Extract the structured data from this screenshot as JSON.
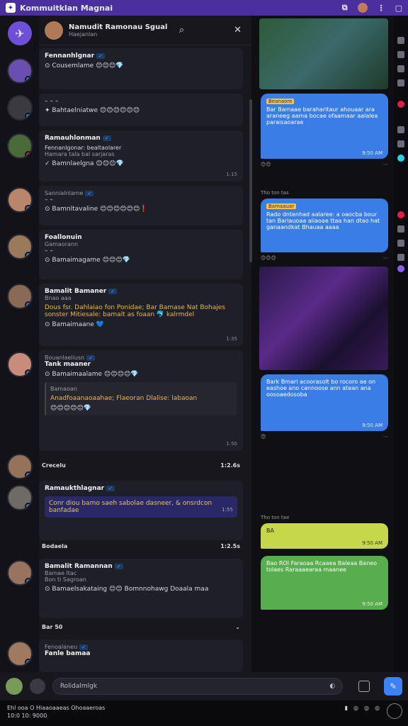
{
  "titlebar": {
    "title": "Kommuitklan Magnai"
  },
  "chat_header": {
    "title": "Namudit Ramonau Sgual",
    "subtitle": "Haejanlan"
  },
  "messages": [
    {
      "name": "Fennanhlgnar",
      "text": "Cousemlame"
    },
    {
      "name": "",
      "text": "Bahtaelniatwe"
    },
    {
      "name": "Ramauhlonman",
      "text": "Fennanlgonar: bealtaolarer",
      "line2": "Hamara tala bal sarjaras",
      "time": "1:15"
    },
    {
      "name": "Sannialnlame",
      "sub": "",
      "text": "Bamnltavaline"
    },
    {
      "name": "Foallonuin",
      "sub": "Gamaorann",
      "text": "Bamaimagame"
    },
    {
      "name": "Bamalit Bamaner",
      "sub": "Bnao aaa",
      "gold": "Dous fsr. Dahlaiao fon Ponidae; Bar Bamase Nat Bohajes sonster Mitiesale: bamalt as foaan 🐬 kalrmdel",
      "text": "Bamaimaane",
      "time": "1:35"
    },
    {
      "name": "Bouanlaeliusn",
      "sub": "Tank maaner",
      "text": "Bamaimaalame",
      "quote_title": "Bamaoan",
      "quote_text": "Anadfoaanaoaahae; Flaeoran Dlalise: labaoan",
      "quote_time": "1:50"
    },
    {
      "name": "Ramaukthlagnar",
      "hl": "Conr diou bamo saeh sabolae dasneer, & onsrdcon banfadae",
      "hl_time": "1:55",
      "text": "Bodaele"
    },
    {
      "name": "Bamalit Ramannan",
      "sub": "Bamae ltac",
      "sub2": "Bon ti Sagroan",
      "text": "Bamaelsakataing",
      "text2": "Bomnnohawg",
      "text3": "Doaala maa"
    },
    {
      "name": "Fenoalaneu",
      "sub": "Fanle bamaa",
      "text": ""
    }
  ],
  "separators": [
    {
      "label": "Crecelu",
      "time": "1:2.6s"
    },
    {
      "label": "Bodaela",
      "time": "1:2.5s"
    },
    {
      "label": "Bar 50",
      "time": ""
    }
  ],
  "side": {
    "bubbles": [
      {
        "tag": "Beanaore",
        "text": "Bar Bamaae baraharitaur ahouaar ara araneeg aama bocae ofaamaar aalalea paraisaoarae",
        "time": "9:50 AM"
      },
      {
        "tag": "Bamaauar",
        "text": "Rado dntenhad aalaree: a oaocba bour tan Bariauoaa aiiaoae ttaa han dtao hat ganaandkat Bhauaa aaaa",
        "time": "9:50 AM"
      },
      {
        "tag": "",
        "text": "Bark Bmarl acoorasolt bo rocoro ae on eashoe ano cannoose ann atean ana oosoaedosoba",
        "time": "9:50 AM"
      },
      {
        "tag": "",
        "text": "BA",
        "time": "9:50 AM"
      },
      {
        "tag": "",
        "text": "Bao ROI Faraoaa Rcaaea Baleaa Baneo tolaes Raraaaearaa maanee",
        "time": "9:50 AM"
      }
    ],
    "meta1": "Tho ton tas",
    "meta2": "Tho ton tae"
  },
  "composer": {
    "placeholder": "Rolidalmlgk"
  },
  "statusbar": {
    "line1": "Ehl ooa O Hiaaoaaeas Ohoaaeroas",
    "line2": "10:0 10: 9000"
  }
}
